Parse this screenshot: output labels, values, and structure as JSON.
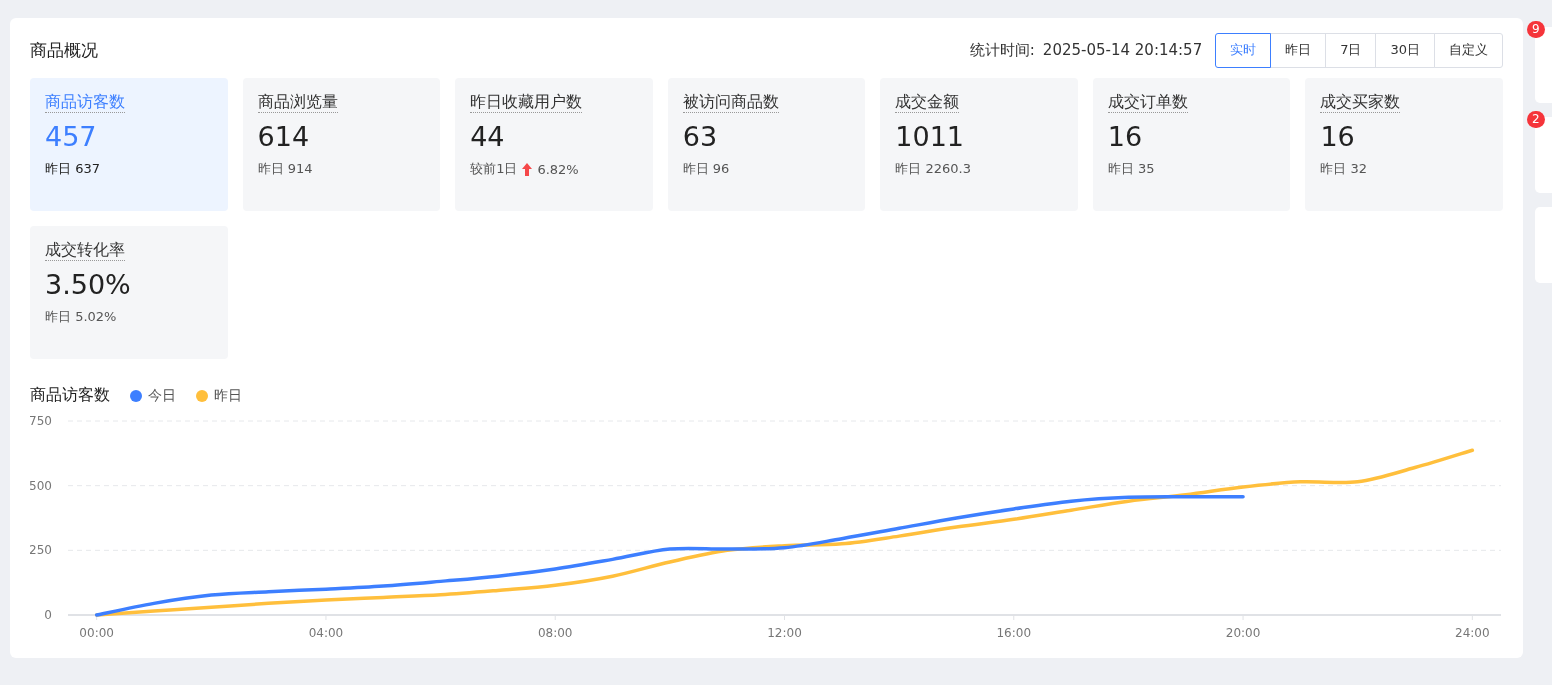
{
  "overview": {
    "title": "商品概况",
    "stat_time_label": "统计时间:",
    "stat_time": "2025-05-14 20:14:57",
    "ranges": [
      {
        "label": "实时",
        "selected": true
      },
      {
        "label": "昨日",
        "selected": false
      },
      {
        "label": "7日",
        "selected": false
      },
      {
        "label": "30日",
        "selected": false
      },
      {
        "label": "自定义",
        "selected": false
      }
    ],
    "metrics": [
      {
        "label": "商品访客数",
        "value": "457",
        "selected": true,
        "kind": "compare",
        "compare": "昨日 637"
      },
      {
        "label": "商品浏览量",
        "value": "614",
        "selected": false,
        "kind": "compare",
        "compare": "昨日 914"
      },
      {
        "label": "昨日收藏用户数",
        "value": "44",
        "selected": false,
        "kind": "trend",
        "compare": "较前1日",
        "rising": true,
        "change": "6.82%"
      },
      {
        "label": "被访问商品数",
        "value": "63",
        "selected": false,
        "kind": "compare",
        "compare": "昨日 96"
      },
      {
        "label": "成交金额",
        "value": "1011",
        "selected": false,
        "kind": "compare",
        "compare": "昨日 2260.3"
      },
      {
        "label": "成交订单数",
        "value": "16",
        "selected": false,
        "kind": "compare",
        "compare": "昨日 35"
      },
      {
        "label": "成交买家数",
        "value": "16",
        "selected": false,
        "kind": "compare",
        "compare": "昨日 32"
      },
      {
        "label": "成交转化率",
        "value": "3.50%",
        "selected": false,
        "kind": "compare",
        "compare": "昨日 5.02%"
      }
    ],
    "chart": {
      "title": "商品访客数",
      "chart_data": {
        "type": "line",
        "x": [
          0,
          1,
          2,
          3,
          4,
          5,
          6,
          7,
          8,
          9,
          10,
          11,
          12,
          13,
          14,
          15,
          16,
          17,
          18,
          19,
          20,
          21,
          22,
          23,
          24
        ],
        "xlim": [
          -0.5,
          24.5
        ],
        "xticks": [
          {
            "value": 0,
            "label": "00:00"
          },
          {
            "value": 4,
            "label": "04:00"
          },
          {
            "value": 8,
            "label": "08:00"
          },
          {
            "value": 12,
            "label": "12:00"
          },
          {
            "value": 16,
            "label": "16:00"
          },
          {
            "value": 20,
            "label": "20:00"
          },
          {
            "value": 24,
            "label": "24:00"
          }
        ],
        "yticks": [
          0,
          250,
          500,
          750
        ],
        "ylim": [
          0,
          750
        ],
        "series": [
          {
            "name": "今日",
            "color": "#3d7fff",
            "values": [
              0,
              45,
              77,
              90,
              100,
              112,
              130,
              150,
              178,
              215,
              255,
              255,
              260,
              295,
              335,
              375,
              410,
              440,
              455,
              457,
              457,
              null,
              null,
              null,
              null
            ]
          },
          {
            "name": "昨日",
            "color": "#ffbf3c",
            "values": [
              0,
              15,
              30,
              45,
              58,
              68,
              78,
              95,
              115,
              150,
              205,
              250,
              268,
              275,
              305,
              340,
              370,
              405,
              440,
              465,
              495,
              515,
              515,
              570,
              637
            ]
          }
        ]
      }
    }
  },
  "side_badges": [
    "9",
    "2"
  ]
}
